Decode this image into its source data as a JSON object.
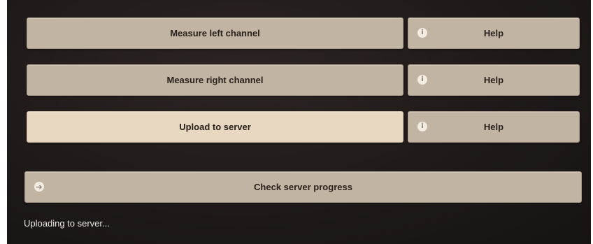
{
  "buttons": {
    "measure_left": "Measure left channel",
    "measure_right": "Measure right channel",
    "upload": "Upload to server",
    "help": "Help",
    "check_progress": "Check server progress"
  },
  "icons": {
    "info": "info-icon",
    "arrow": "arrow-right-icon"
  },
  "status": {
    "text": "Uploading to server..."
  },
  "colors": {
    "panel_bg": "#1f1a19",
    "button_bg": "#c2b4a3",
    "button_active_bg": "#e8d8c2",
    "button_text": "#2a211c",
    "status_text": "#e9e5e0"
  }
}
